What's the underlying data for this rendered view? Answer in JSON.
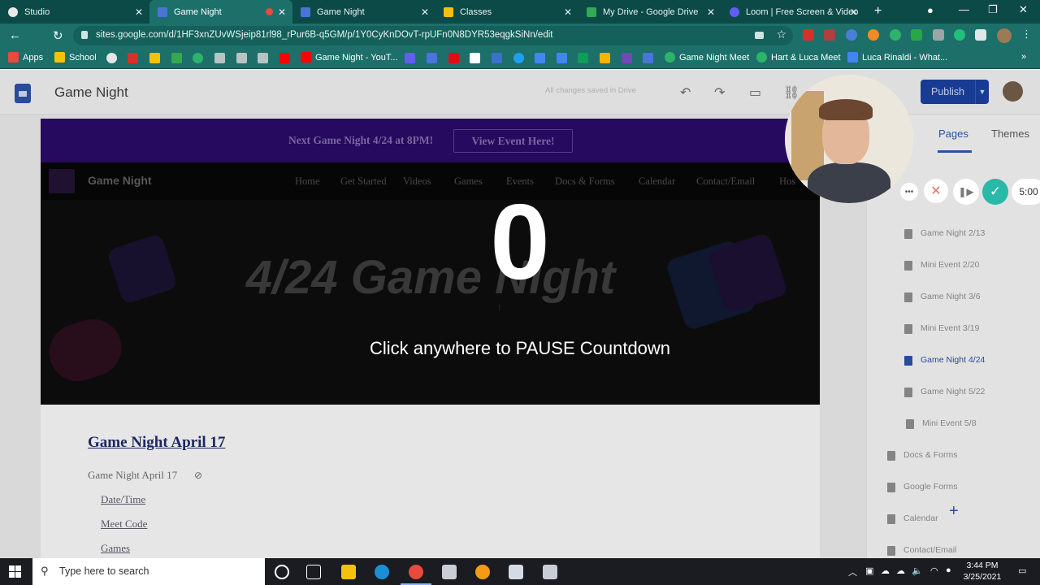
{
  "browser": {
    "tabs": [
      {
        "label": "Studio",
        "color": "#e8e8e8"
      },
      {
        "label": "Game Night",
        "color": "#4b74d8"
      },
      {
        "label": "Game Night",
        "color": "#4b74d8"
      },
      {
        "label": "Classes",
        "color": "#f4c20d"
      },
      {
        "label": "My Drive - Google Drive",
        "color": "#34a853"
      },
      {
        "label": "Loom | Free Screen & Video",
        "color": "#625df5"
      }
    ],
    "url": "sites.google.com/d/1HF3xnZUvWSjeip81rl98_rPur6B-q5GM/p/1Y0CyKnDOvT-rpUFn0N8DYR53eqgkSiNn/edit",
    "bookmarks": [
      {
        "label": "Apps"
      },
      {
        "label": "School"
      },
      {
        "label": "Game Night - YouT..."
      },
      {
        "label": "Game Night Meet"
      },
      {
        "label": "Hart & Luca Meet"
      },
      {
        "label": "Luca Rinaldi - What..."
      }
    ]
  },
  "editor": {
    "title": "Game Night",
    "saved_status": "All changes saved in Drive",
    "publish_label": "Publish",
    "right_panel": {
      "tabs": [
        "Pages",
        "Themes"
      ],
      "pages": [
        {
          "label": "Game Night 2/13",
          "active": false
        },
        {
          "label": "Mini Event 2/20",
          "active": false
        },
        {
          "label": "Game Night 3/6",
          "active": false
        },
        {
          "label": "Mini Event 3/19",
          "active": false
        },
        {
          "label": "Game Night 4/24",
          "active": true
        },
        {
          "label": "Game Night 5/22",
          "active": false
        },
        {
          "label": "Mini Event 5/8",
          "active": false
        },
        {
          "label": "Docs & Forms",
          "active": false
        },
        {
          "label": "Google Forms",
          "active": false
        },
        {
          "label": "Calendar",
          "active": false
        },
        {
          "label": "Contact/Email",
          "active": false
        }
      ]
    }
  },
  "site": {
    "banner_text": "Next Game Night 4/24 at 8PM!",
    "banner_button": "View Event Here!",
    "site_title": "Game Night",
    "nav": [
      "Home",
      "Get Started",
      "Videos",
      "Games",
      "Events",
      "Docs & Forms",
      "Calendar",
      "Contact/Email",
      "Hos"
    ],
    "hero_title": "4/24 Game Night",
    "section_heading": "Game Night April 17",
    "section_subtitle": "Game Night April 17",
    "links": [
      "Date/Time",
      "Meet Code",
      "Games"
    ]
  },
  "loom": {
    "countdown": "0",
    "pause_message": "Click anywhere to PAUSE Countdown",
    "timer": "5:00"
  },
  "taskbar": {
    "search_placeholder": "Type here to search",
    "time": "3:44 PM",
    "date": "3/25/2021"
  }
}
